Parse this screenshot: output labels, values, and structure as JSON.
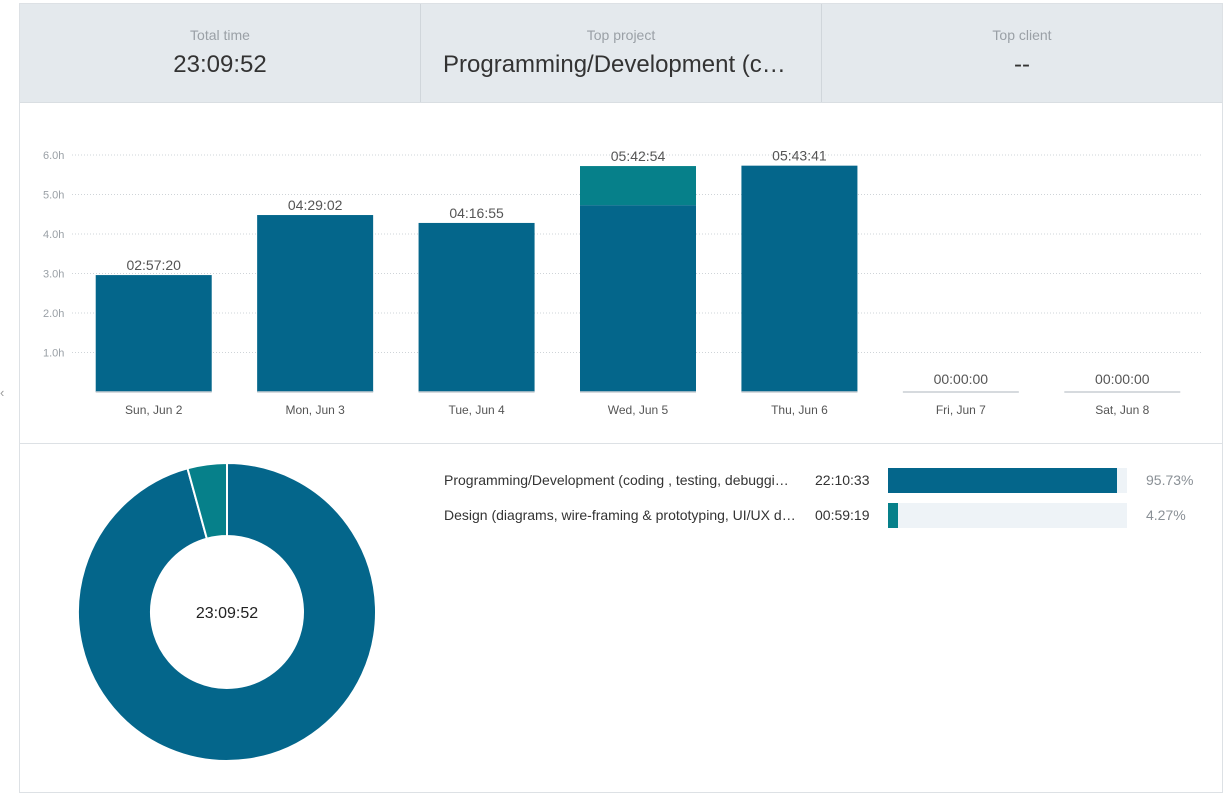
{
  "summary": {
    "total_time_label": "Total time",
    "total_time_value": "23:09:52",
    "top_project_label": "Top project",
    "top_project_value": "Programming/Development (coding , testing, debugging...)",
    "top_client_label": "Top client",
    "top_client_value": "--"
  },
  "colors": {
    "programming": "#04668b",
    "design": "#06808a",
    "grid": "#cfd4d8",
    "empty_bar": "#c9ced3",
    "stats_bg": "#e4e9ed"
  },
  "chart_data": [
    {
      "type": "bar",
      "stacked": true,
      "categories": [
        "Sun, Jun 2",
        "Mon, Jun 3",
        "Tue, Jun 4",
        "Wed, Jun 5",
        "Thu, Jun 6",
        "Fri, Jun 7",
        "Sat, Jun 8"
      ],
      "totals": [
        "02:57:20",
        "04:29:02",
        "04:16:55",
        "05:42:54",
        "05:43:41",
        "00:00:00",
        "00:00:00"
      ],
      "series": [
        {
          "values": [
            2.96,
            4.48,
            4.28,
            4.73,
            5.73,
            0,
            0
          ],
          "color": "#04668b"
        },
        {
          "values": [
            0,
            0,
            0,
            0.99,
            0,
            0,
            0
          ],
          "color": "#06808a"
        }
      ],
      "yticks": [
        "1.0h",
        "2.0h",
        "3.0h",
        "4.0h",
        "5.0h",
        "6.0h"
      ],
      "ylim": [
        0,
        6
      ],
      "grid": true
    },
    {
      "type": "pie",
      "donut": true,
      "center_label": "23:09:52",
      "slices": [
        {
          "value": 95.73,
          "color": "#04668b"
        },
        {
          "value": 4.27,
          "color": "#06808a"
        }
      ]
    }
  ],
  "projects": [
    {
      "name": "Programming/Development (coding , testing, debugging...)",
      "time": "22:10:33",
      "percent_label": "95.73%",
      "fraction": 0.9573,
      "color": "#04668b"
    },
    {
      "name": "Design (diagrams, wire-framing & prototyping, UI/UX design)",
      "time": "00:59:19",
      "percent_label": "4.27%",
      "fraction": 0.0427,
      "color": "#06808a"
    }
  ]
}
